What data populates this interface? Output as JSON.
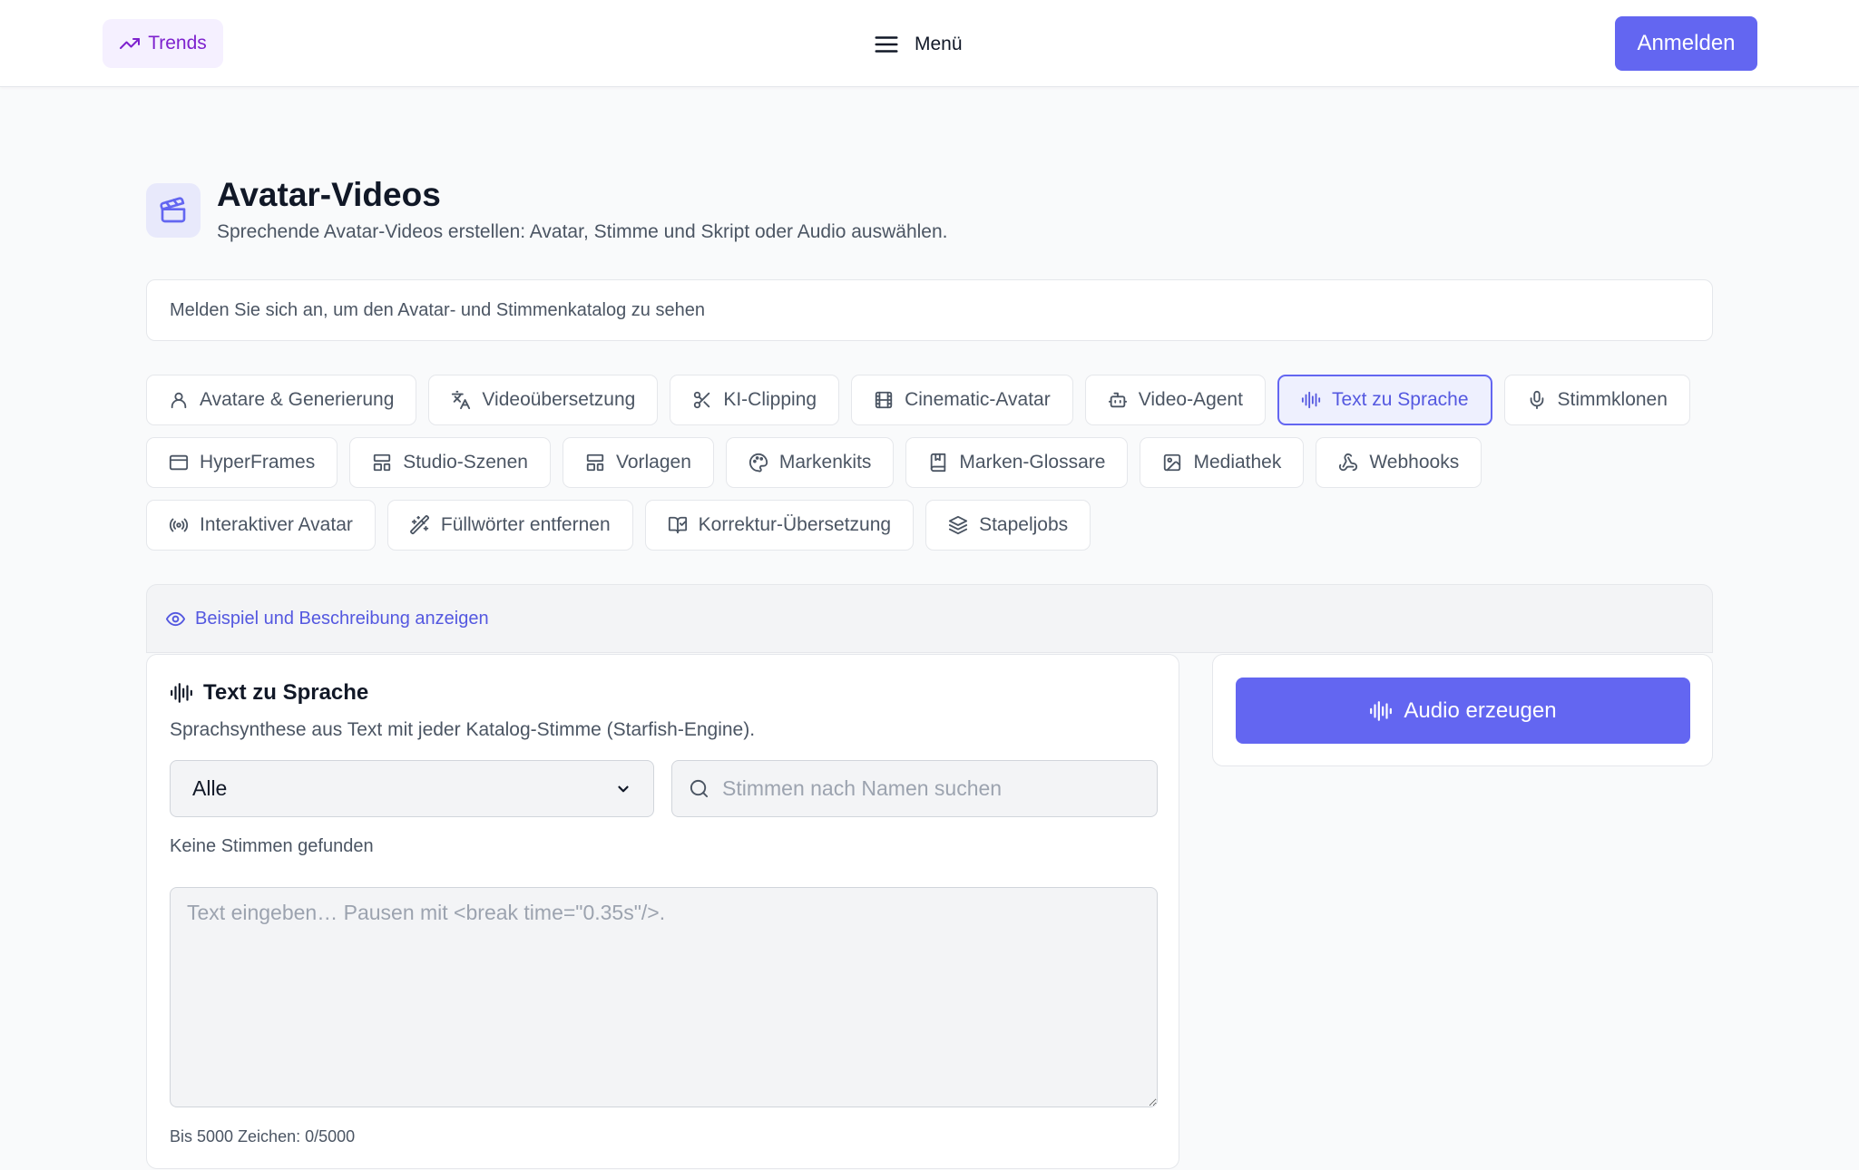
{
  "header": {
    "trends_label": "Trends",
    "menu_label": "Menü",
    "login_label": "Anmelden"
  },
  "page": {
    "title": "Avatar-Videos",
    "subtitle": "Sprechende Avatar-Videos erstellen: Avatar, Stimme und Skript oder Audio auswählen.",
    "login_hint": "Melden Sie sich an, um den Avatar- und Stimmenkatalog zu sehen"
  },
  "tabs": [
    {
      "label": "Avatare & Generierung",
      "icon": "user-icon"
    },
    {
      "label": "Videoübersetzung",
      "icon": "translate-icon"
    },
    {
      "label": "KI-Clipping",
      "icon": "scissors-icon"
    },
    {
      "label": "Cinematic-Avatar",
      "icon": "film-icon"
    },
    {
      "label": "Video-Agent",
      "icon": "bot-icon"
    },
    {
      "label": "Text zu Sprache",
      "icon": "audio-waveform-icon",
      "active": true
    },
    {
      "label": "Stimmklonen",
      "icon": "microphone-icon"
    },
    {
      "label": "HyperFrames",
      "icon": "browser-window-icon"
    },
    {
      "label": "Studio-Szenen",
      "icon": "layout-icon"
    },
    {
      "label": "Vorlagen",
      "icon": "template-icon"
    },
    {
      "label": "Markenkits",
      "icon": "palette-icon"
    },
    {
      "label": "Marken-Glossare",
      "icon": "book-icon"
    },
    {
      "label": "Mediathek",
      "icon": "image-icon"
    },
    {
      "label": "Webhooks",
      "icon": "webhook-icon"
    },
    {
      "label": "Interaktiver Avatar",
      "icon": "broadcast-icon"
    },
    {
      "label": "Füllwörter entfernen",
      "icon": "magic-wand-icon"
    },
    {
      "label": "Korrektur-Übersetzung",
      "icon": "book-check-icon"
    },
    {
      "label": "Stapeljobs",
      "icon": "layers-icon"
    }
  ],
  "example": {
    "label": "Beispiel und Beschreibung anzeigen"
  },
  "tts": {
    "title": "Text zu Sprache",
    "description": "Sprachsynthese aus Text mit jeder Katalog-Stimme (Starfish-Engine).",
    "filter_value": "Alle",
    "search_placeholder": "Stimmen nach Namen suchen",
    "no_voices": "Keine Stimmen gefunden",
    "text_placeholder": "Text eingeben… Pausen mit <break time=\"0.35s\"/>.",
    "char_count": "Bis 5000 Zeichen: 0/5000"
  },
  "actions": {
    "generate_label": "Audio erzeugen"
  },
  "colors": {
    "accent": "#6366f1",
    "trends": "#7e22ce"
  }
}
